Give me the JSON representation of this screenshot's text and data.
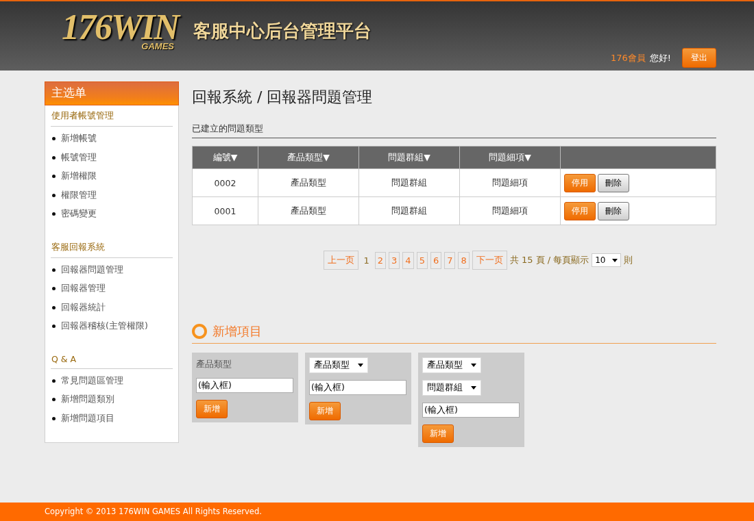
{
  "header": {
    "logo": "176WIN",
    "logo_sub": "GAMES",
    "title": "客服中心后台管理平台",
    "user": "176會員",
    "greeting": "您好!",
    "logout": "登出"
  },
  "sidebar": {
    "title": "主选单",
    "sections": [
      {
        "heading": "使用者帳號管理",
        "items": [
          "新增帳號",
          "帳號管理",
          "新增權限",
          "權限管理",
          "密碼變更"
        ]
      },
      {
        "heading": "客服回報系統",
        "items": [
          "回報器問題管理",
          "回報器管理",
          "回報器統計",
          "回報器稽核(主管權限)"
        ]
      },
      {
        "heading": "Q & A",
        "items": [
          "常見問題區管理",
          "新增問題類別",
          "新增問題項目"
        ]
      }
    ]
  },
  "page_title": "回報系統 / 回報器問題管理",
  "table": {
    "caption": "已建立的問題類型",
    "columns": [
      "編號▼",
      "產品類型▼",
      "問題群組▼",
      "問題細項▼"
    ],
    "rows": [
      {
        "cells": [
          "0002",
          "產品類型",
          "問題群組",
          "問題細項"
        ],
        "actions": [
          "停用",
          "刪除"
        ]
      },
      {
        "cells": [
          "0001",
          "產品類型",
          "問題群組",
          "問題細項"
        ],
        "actions": [
          "停用",
          "刪除"
        ]
      }
    ]
  },
  "pagination": {
    "prev": "上一页",
    "next": "下一页",
    "pages": [
      {
        "label": "1",
        "selected": true
      },
      {
        "label": "2",
        "selected": false
      },
      {
        "label": "3",
        "selected": false
      },
      {
        "label": "4",
        "selected": false
      },
      {
        "label": "5",
        "selected": false
      },
      {
        "label": "6",
        "selected": false
      },
      {
        "label": "7",
        "selected": false
      },
      {
        "label": "8",
        "selected": false
      }
    ],
    "summary": "共 15 頁 / 每頁顯示",
    "per_page": "10",
    "unit": "則"
  },
  "add_section": {
    "title": "新增項目",
    "cards": [
      {
        "fields": [
          {
            "kind": "label",
            "text": "產品類型"
          },
          {
            "kind": "input",
            "value": "(輸入框)"
          }
        ],
        "button": "新增"
      },
      {
        "fields": [
          {
            "kind": "select",
            "text": "產品類型"
          },
          {
            "kind": "input",
            "value": "(輸入框)"
          }
        ],
        "button": "新增"
      },
      {
        "fields": [
          {
            "kind": "select",
            "text": "產品類型"
          },
          {
            "kind": "select",
            "text": "問題群組"
          },
          {
            "kind": "input",
            "value": "(輸入框)"
          }
        ],
        "button": "新增"
      }
    ]
  },
  "footer": "Copyright © 2013 176WIN GAMES All Rights Reserved."
}
